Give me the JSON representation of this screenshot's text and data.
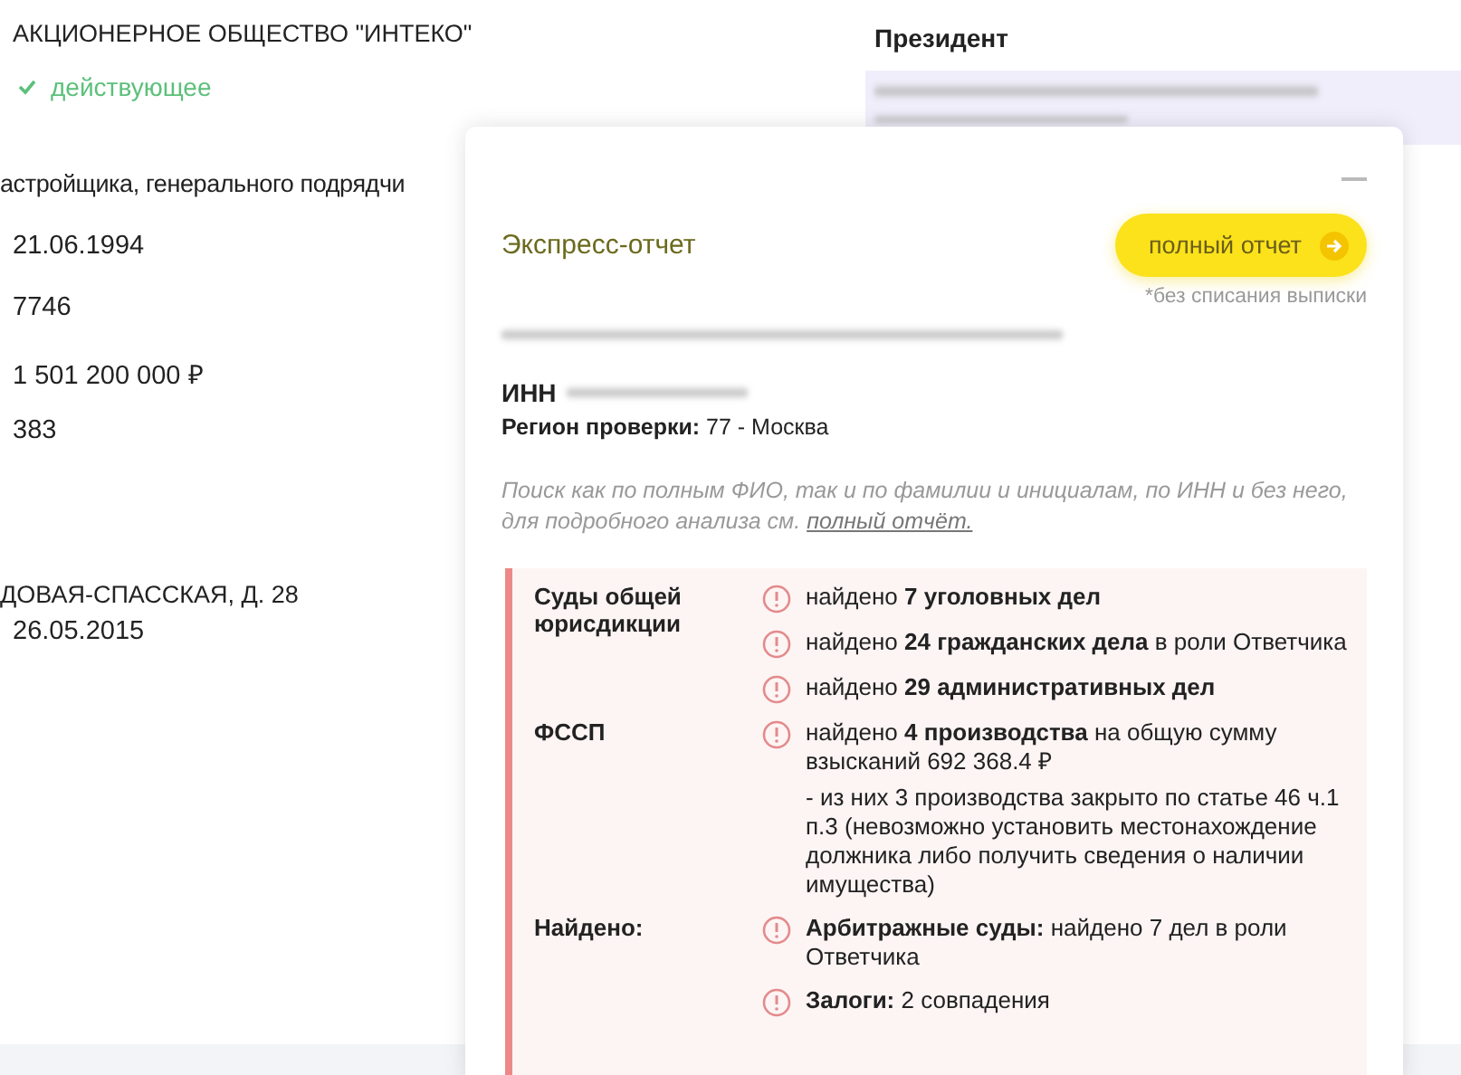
{
  "company": {
    "name": "АКЦИОНЕРНОЕ ОБЩЕСТВО \"ИНТЕКО\"",
    "status": "действующее",
    "activity": "астройщика, генерального подрядчи",
    "values": [
      "21.06.1994",
      "7746",
      "1 501 200 000 ₽",
      "383"
    ],
    "address": "ДОВАЯ-СПАССКАЯ, Д. 28",
    "address_date": "26.05.2015"
  },
  "president": {
    "title": "Президент"
  },
  "report": {
    "title": "Экспресс-отчет",
    "button": "полный отчет",
    "note": "*без списания выписки",
    "inn_label": "ИНН",
    "region": "**Регион проверки:** 77 - Москва",
    "hint": "Поиск как по полным ФИО, так и по фамилии и инициалам, по ИНН и без него, для подробного анализа см. ",
    "hint_link": "полный отчёт.",
    "findings": [
      {
        "label": "Суды общей юрисдикции",
        "items": [
          {
            "text": "найдено **7 уголовных дел**"
          },
          {
            "text": "найдено **24 гражданских дела** в роли Ответчика"
          },
          {
            "text": "найдено **29 административных дел**"
          }
        ]
      },
      {
        "label": "ФССП",
        "items": [
          {
            "text": "найдено **4 производства** на общую сумму взысканий 692 368.4 ₽",
            "note": "- из них 3 производства закрыто по статье 46 ч.1 п.3 (невозможно установить местонахождение должника либо получить сведения о наличии имущества)"
          }
        ]
      },
      {
        "label": "Найдено:",
        "items": [
          {
            "text": "**Арбитражные суды:** найдено 7 дел в роли Ответчика"
          },
          {
            "text": "**Залоги:** 2 совпадения"
          }
        ]
      }
    ]
  }
}
